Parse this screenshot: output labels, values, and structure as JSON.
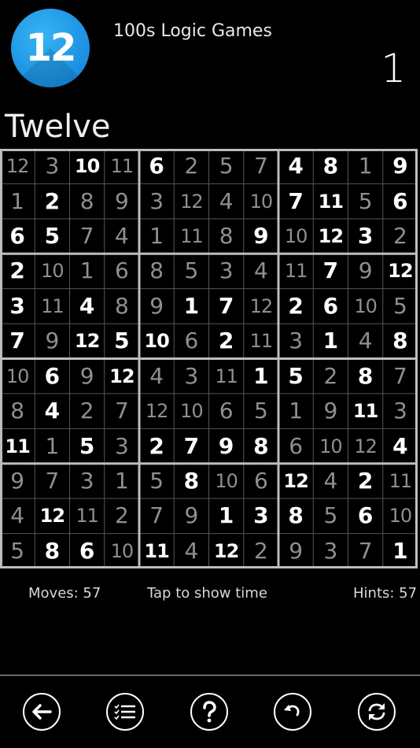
{
  "header": {
    "logo_text": "12",
    "app_title": "100s Logic Games",
    "level_number": "1",
    "puzzle_title": "Twelve"
  },
  "grid": {
    "rows": [
      [
        "12",
        "3",
        "10",
        "11",
        "6",
        "2",
        "5",
        "7",
        "4",
        "8",
        "1",
        "9"
      ],
      [
        "1",
        "2",
        "8",
        "9",
        "3",
        "12",
        "4",
        "10",
        "7",
        "11",
        "5",
        "6"
      ],
      [
        "6",
        "5",
        "7",
        "4",
        "1",
        "11",
        "8",
        "9",
        "10",
        "12",
        "3",
        "2"
      ],
      [
        "2",
        "10",
        "1",
        "6",
        "8",
        "5",
        "3",
        "4",
        "11",
        "7",
        "9",
        "12"
      ],
      [
        "3",
        "11",
        "4",
        "8",
        "9",
        "1",
        "7",
        "12",
        "2",
        "6",
        "10",
        "5"
      ],
      [
        "7",
        "9",
        "12",
        "5",
        "10",
        "6",
        "2",
        "11",
        "3",
        "1",
        "4",
        "8"
      ],
      [
        "10",
        "6",
        "9",
        "12",
        "4",
        "3",
        "11",
        "1",
        "5",
        "2",
        "8",
        "7"
      ],
      [
        "8",
        "4",
        "2",
        "7",
        "12",
        "10",
        "6",
        "5",
        "1",
        "9",
        "11",
        "3"
      ],
      [
        "11",
        "1",
        "5",
        "3",
        "2",
        "7",
        "9",
        "8",
        "6",
        "10",
        "12",
        "4"
      ],
      [
        "9",
        "7",
        "3",
        "1",
        "5",
        "8",
        "10",
        "6",
        "12",
        "4",
        "2",
        "11"
      ],
      [
        "4",
        "12",
        "11",
        "2",
        "7",
        "9",
        "1",
        "3",
        "8",
        "5",
        "6",
        "10"
      ],
      [
        "5",
        "8",
        "6",
        "10",
        "11",
        "4",
        "12",
        "2",
        "9",
        "3",
        "7",
        "1"
      ]
    ],
    "given": [
      [
        0,
        0,
        1,
        0,
        1,
        0,
        0,
        0,
        1,
        1,
        0,
        1
      ],
      [
        0,
        1,
        0,
        0,
        0,
        0,
        0,
        0,
        1,
        1,
        0,
        1
      ],
      [
        1,
        1,
        0,
        0,
        0,
        0,
        0,
        1,
        0,
        1,
        1,
        0
      ],
      [
        1,
        0,
        0,
        0,
        0,
        0,
        0,
        0,
        0,
        1,
        0,
        1
      ],
      [
        1,
        0,
        1,
        0,
        0,
        1,
        1,
        0,
        1,
        1,
        0,
        0
      ],
      [
        1,
        0,
        1,
        1,
        1,
        0,
        1,
        0,
        0,
        1,
        0,
        1
      ],
      [
        0,
        1,
        0,
        1,
        0,
        0,
        0,
        1,
        1,
        0,
        1,
        0
      ],
      [
        0,
        1,
        0,
        0,
        0,
        0,
        0,
        0,
        0,
        0,
        1,
        0
      ],
      [
        1,
        0,
        1,
        0,
        1,
        1,
        1,
        1,
        0,
        0,
        0,
        1
      ],
      [
        0,
        0,
        0,
        0,
        0,
        1,
        0,
        0,
        1,
        0,
        1,
        0
      ],
      [
        0,
        1,
        0,
        0,
        0,
        0,
        1,
        1,
        1,
        0,
        1,
        0
      ],
      [
        0,
        1,
        1,
        0,
        1,
        0,
        1,
        0,
        0,
        0,
        0,
        1
      ]
    ],
    "colors": {
      "given": "#ffffff",
      "entered": "#8f8f8f",
      "thin_line": "#555555",
      "thick_line": "#bdbdbd"
    }
  },
  "status": {
    "moves": "Moves: 57",
    "time_prompt": "Tap to show time",
    "hints": "Hints: 57"
  },
  "toolbar": {
    "back": "arrow-left-icon",
    "menu": "list-icon",
    "help": "question-icon",
    "undo": "undo-icon",
    "reset": "refresh-icon"
  }
}
